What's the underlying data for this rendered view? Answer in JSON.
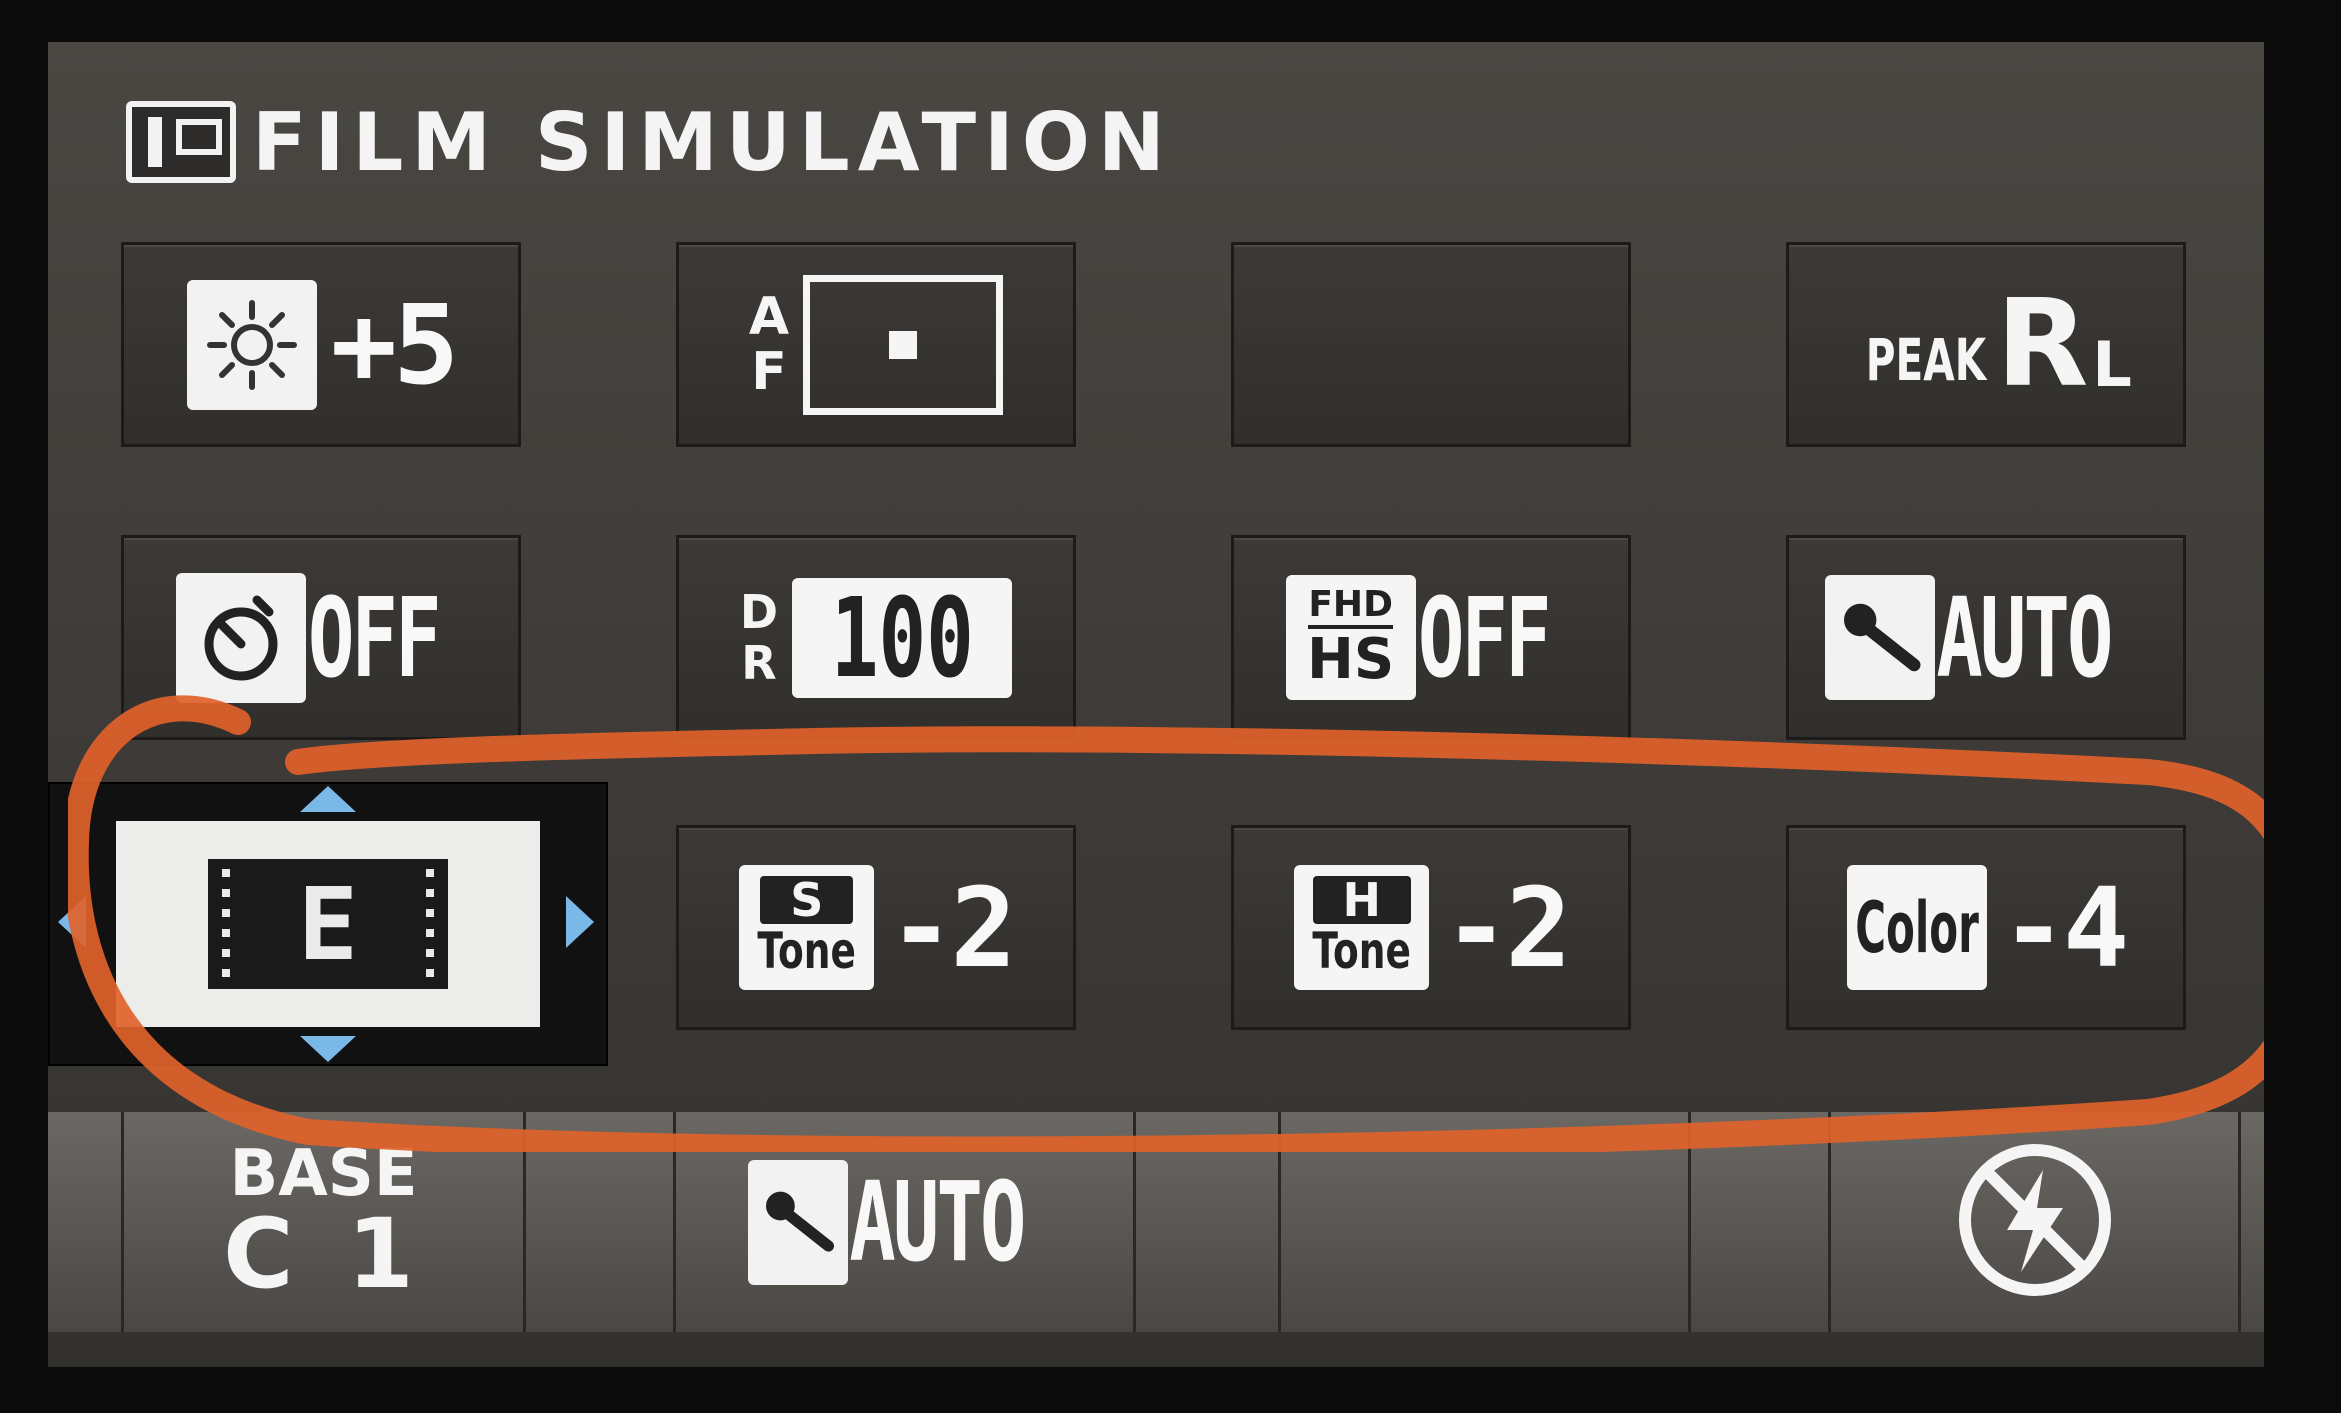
{
  "header": {
    "title": "FILM SIMULATION",
    "icon": "film-simulation-icon"
  },
  "tiles": {
    "brightness": {
      "icon": "brightness-sun-icon",
      "value": "+5"
    },
    "af_mode": {
      "icon": "af-frame-icon",
      "label_a": "A",
      "label_f": "F"
    },
    "empty": {
      "label": ""
    },
    "peak": {
      "label_peak": "PEAK",
      "label_r": "R",
      "label_l": "L"
    },
    "self_timer": {
      "icon": "self-timer-icon",
      "value": "OFF"
    },
    "dynamic_range": {
      "label_d": "D",
      "label_r": "R",
      "value": "100"
    },
    "fhd_hs": {
      "label_top": "FHD",
      "label_bottom": "HS",
      "value": "OFF"
    },
    "mic_level": {
      "icon": "microphone-icon",
      "value": "AUTO"
    },
    "film_sim": {
      "letter": "E",
      "icon": "film-e-icon"
    },
    "shadow_tone": {
      "badge_letter": "S",
      "badge_label": "Tone",
      "value": "-2"
    },
    "highlight_tone": {
      "badge_letter": "H",
      "badge_label": "Tone",
      "value": "-2"
    },
    "color": {
      "badge_label": "Color",
      "value": "-4"
    }
  },
  "bottom_bar": {
    "base_top": "BASE",
    "base_bottom": "C 1",
    "mic_value": "AUTO",
    "mic_icon": "microphone-icon",
    "flash_icon": "flash-off-icon"
  },
  "colors": {
    "annotation": "#e0622a",
    "selection_arrow": "#7ab8e8",
    "panel": "#3d3a37"
  }
}
